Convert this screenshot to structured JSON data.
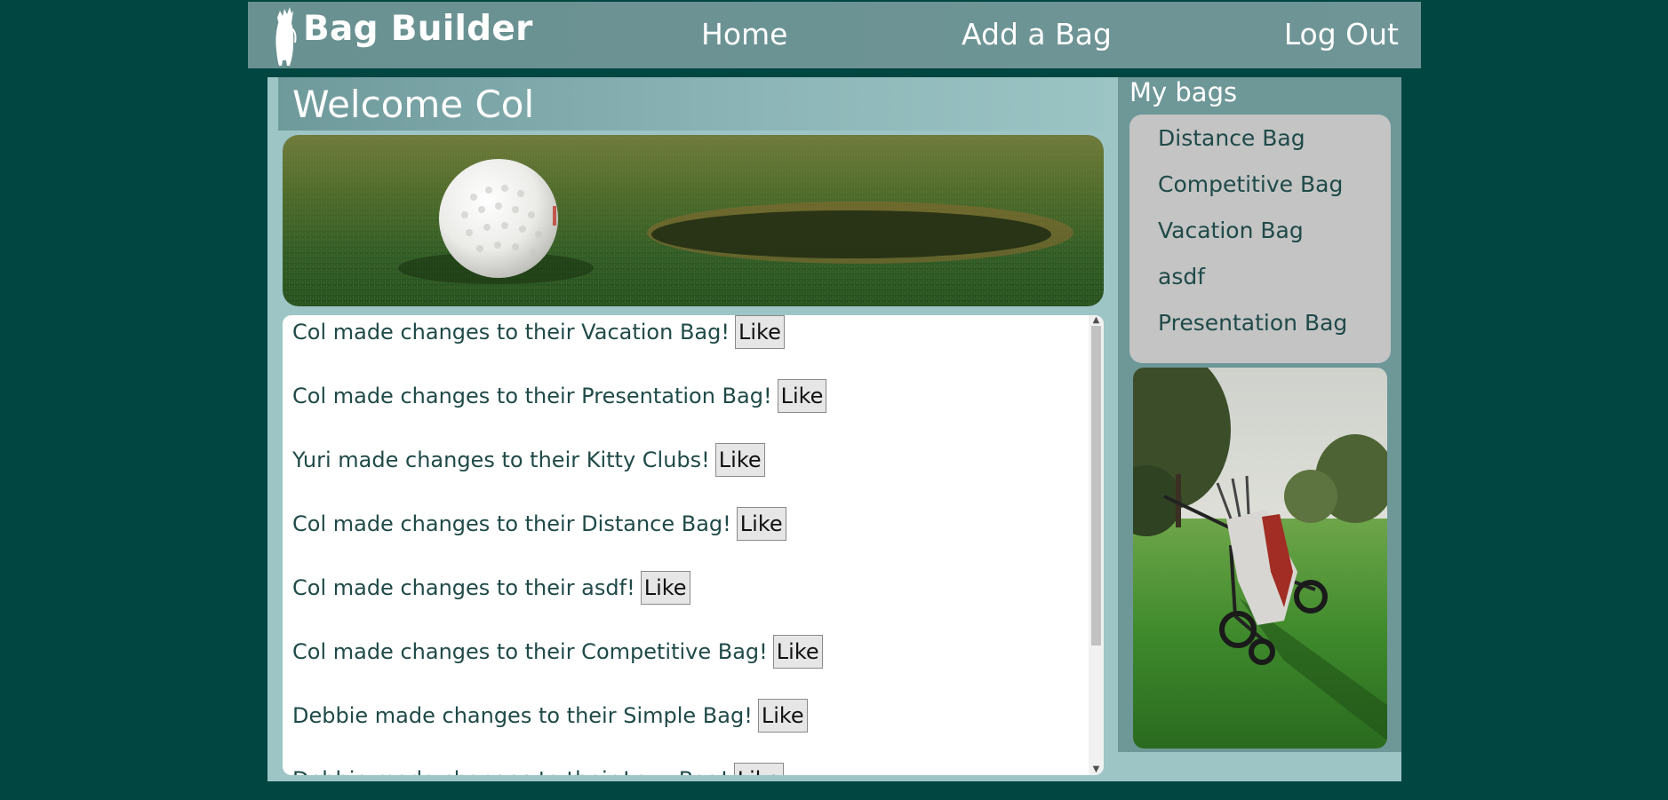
{
  "header": {
    "logo_text": "Bag Builder",
    "nav": {
      "home": "Home",
      "add_bag": "Add a Bag",
      "log_out": "Log Out"
    }
  },
  "welcome": {
    "title": "Welcome Col"
  },
  "feed": {
    "like_label": "Like",
    "items": [
      "Col made changes to their Vacation Bag!",
      "Col made changes to their Presentation Bag!",
      "Yuri made changes to their Kitty Clubs!",
      "Col made changes to their Distance Bag!",
      "Col made changes to their asdf!",
      "Col made changes to their Competitive Bag!",
      "Debbie made changes to their Simple Bag!",
      "Debbie made changes to their Lazy Bag!"
    ]
  },
  "sidebar": {
    "title": "My bags",
    "bags": [
      "Distance Bag",
      "Competitive Bag",
      "Vacation Bag",
      "asdf",
      "Presentation Bag"
    ]
  },
  "colors": {
    "page_background": "#014641",
    "header_background": "#6a9191",
    "panel_background": "#9dc5c6",
    "sidebar_background": "#6e9798",
    "text_dark": "#1f4a48"
  }
}
